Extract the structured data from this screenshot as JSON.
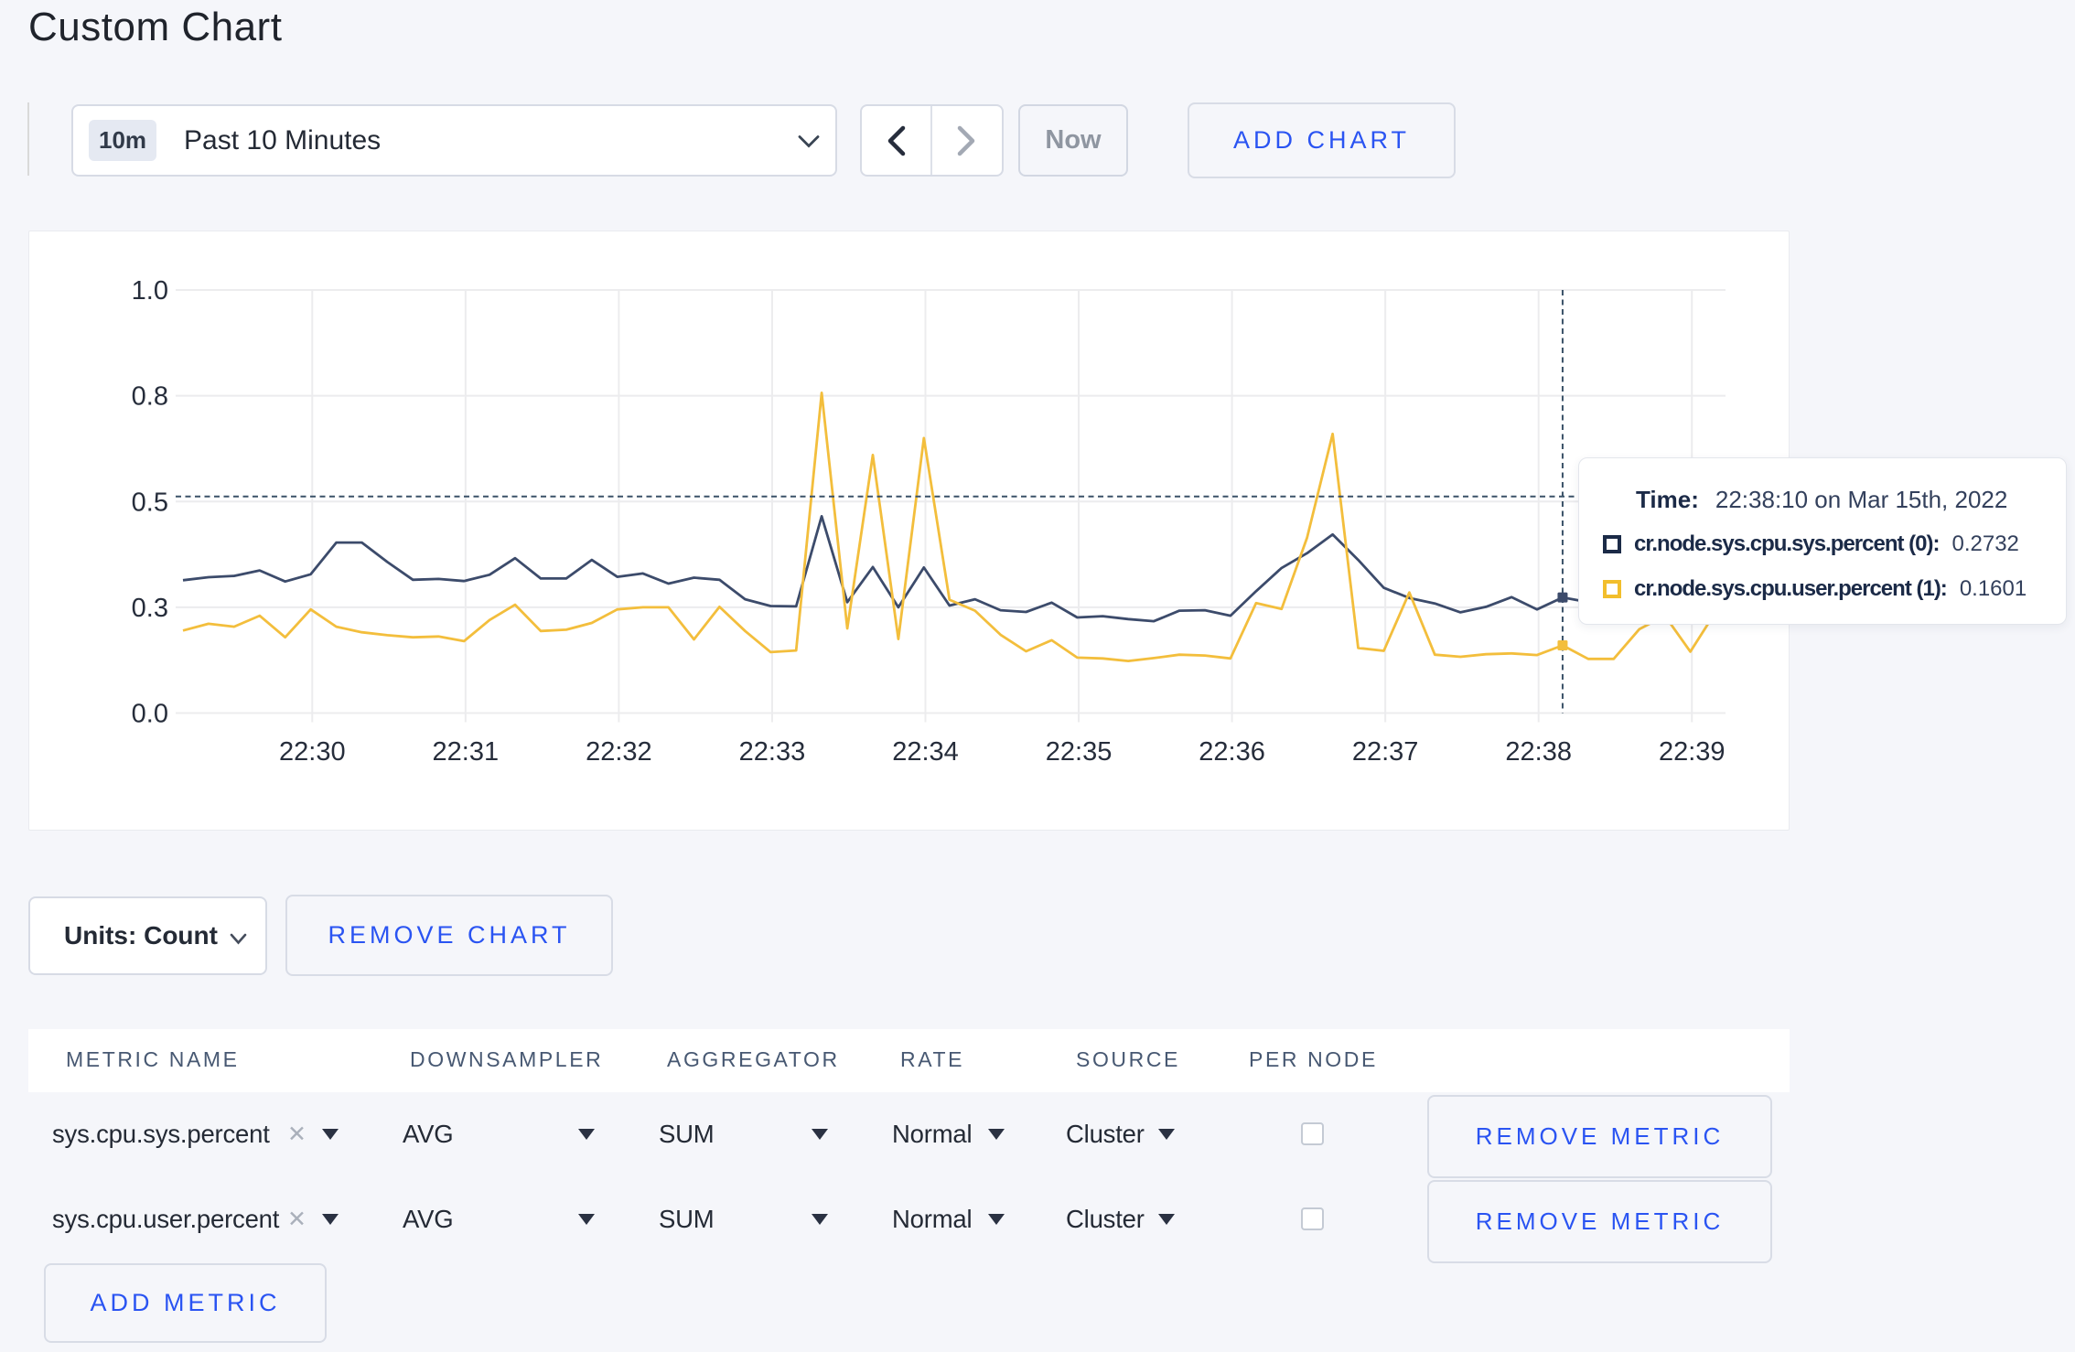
{
  "page": {
    "title": "Custom Chart",
    "background": "#f5f6fa",
    "accent_blue": "#2a54f2"
  },
  "toolbar": {
    "time_window_badge": "10m",
    "time_window_label": "Past 10 Minutes",
    "now_label": "Now",
    "add_chart_label": "ADD CHART"
  },
  "chart_data": {
    "type": "line",
    "title": "",
    "xlabel": "",
    "ylabel": "",
    "ylim": [
      0,
      1
    ],
    "y_tick_values": [
      0,
      0.25,
      0.5,
      0.75,
      1.0
    ],
    "y_tick_labels": [
      "0.0",
      "0.3",
      "0.5",
      "0.8",
      "1.0"
    ],
    "x_tick_labels": [
      "22:30",
      "22:31",
      "22:32",
      "22:33",
      "22:34",
      "22:35",
      "22:36",
      "22:37",
      "22:38",
      "22:39"
    ],
    "x_start_time": "22:29:10",
    "sample_interval_seconds": 10,
    "grid": true,
    "legend_position": "tooltip",
    "crosshair": {
      "hover_index": 54,
      "hover_time": "22:38:10",
      "mouse_y_value": 0.512,
      "color": "#3b5268"
    },
    "series": [
      {
        "name": "cr.node.sys.cpu.sys.percent",
        "color": "#3c4b6b",
        "values": [
          0.314,
          0.321,
          0.324,
          0.337,
          0.311,
          0.328,
          0.403,
          0.403,
          0.357,
          0.315,
          0.317,
          0.312,
          0.327,
          0.366,
          0.318,
          0.318,
          0.362,
          0.322,
          0.33,
          0.306,
          0.32,
          0.315,
          0.269,
          0.253,
          0.252,
          0.465,
          0.262,
          0.345,
          0.25,
          0.344,
          0.254,
          0.269,
          0.243,
          0.239,
          0.261,
          0.226,
          0.229,
          0.222,
          0.217,
          0.242,
          0.243,
          0.23,
          0.288,
          0.343,
          0.378,
          0.422,
          0.362,
          0.296,
          0.272,
          0.259,
          0.238,
          0.251,
          0.274,
          0.245,
          0.2732,
          0.262,
          0.27,
          0.283,
          0.272,
          0.29,
          0.302,
          0.315
        ]
      },
      {
        "name": "cr.node.sys.cpu.user.percent",
        "color": "#f3be3c",
        "values": [
          0.195,
          0.211,
          0.204,
          0.23,
          0.179,
          0.245,
          0.204,
          0.191,
          0.184,
          0.179,
          0.181,
          0.17,
          0.22,
          0.256,
          0.194,
          0.197,
          0.213,
          0.245,
          0.25,
          0.25,
          0.174,
          0.251,
          0.194,
          0.144,
          0.148,
          0.757,
          0.2,
          0.61,
          0.175,
          0.65,
          0.268,
          0.242,
          0.185,
          0.146,
          0.172,
          0.131,
          0.129,
          0.123,
          0.13,
          0.138,
          0.136,
          0.129,
          0.26,
          0.246,
          0.415,
          0.66,
          0.154,
          0.147,
          0.285,
          0.138,
          0.133,
          0.139,
          0.141,
          0.137,
          0.1601,
          0.128,
          0.128,
          0.198,
          0.23,
          0.145,
          0.24,
          0.27
        ]
      }
    ]
  },
  "tooltip": {
    "time_label": "Time:",
    "time_value": "22:38:10 on Mar 15th, 2022",
    "series": [
      {
        "label": "cr.node.sys.cpu.sys.percent (0):",
        "value": "0.2732",
        "color": "#1b2a47"
      },
      {
        "label": "cr.node.sys.cpu.user.percent (1):",
        "value": "0.1601",
        "color": "#f2be2c"
      }
    ]
  },
  "chart_controls": {
    "units_label": "Units: Count",
    "remove_chart_label": "REMOVE CHART"
  },
  "metrics_table": {
    "columns": [
      "METRIC NAME",
      "DOWNSAMPLER",
      "AGGREGATOR",
      "RATE",
      "SOURCE",
      "PER NODE"
    ],
    "rows": [
      {
        "metric_name": "sys.cpu.sys.percent",
        "downsampler": "AVG",
        "aggregator": "SUM",
        "rate": "Normal",
        "source": "Cluster",
        "per_node_checked": false,
        "remove_label": "REMOVE METRIC"
      },
      {
        "metric_name": "sys.cpu.user.percent",
        "downsampler": "AVG",
        "aggregator": "SUM",
        "rate": "Normal",
        "source": "Cluster",
        "per_node_checked": false,
        "remove_label": "REMOVE METRIC"
      }
    ],
    "add_metric_label": "ADD METRIC"
  }
}
